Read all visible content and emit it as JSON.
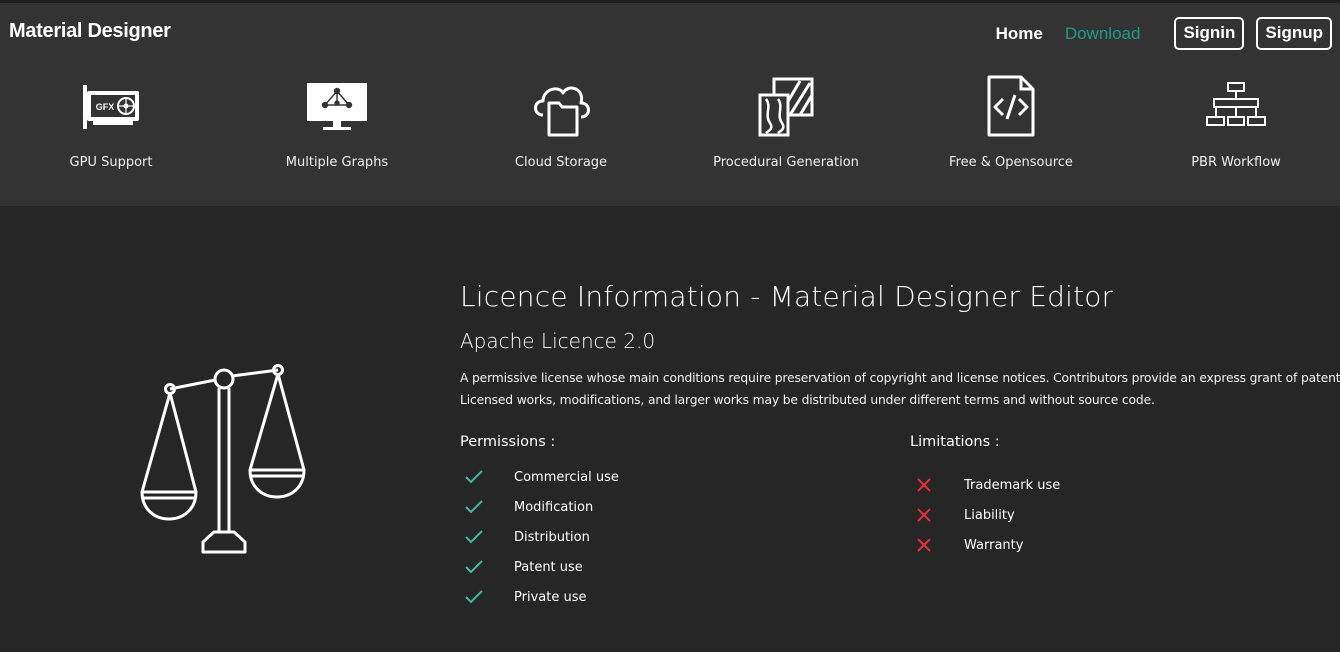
{
  "header": {
    "brand": "Material Designer",
    "nav": {
      "home": "Home",
      "download": "Download",
      "signin": "Signin",
      "signup": "Signup"
    },
    "active_color": "#1d9a8a"
  },
  "features": [
    {
      "label": "GPU Support",
      "icon": "gpu-card-icon",
      "icon_text": "GFX"
    },
    {
      "label": "Multiple Graphs",
      "icon": "graph-monitor-icon"
    },
    {
      "label": "Cloud Storage",
      "icon": "cloud-folder-icon"
    },
    {
      "label": "Procedural Generation",
      "icon": "procedural-pattern-icon"
    },
    {
      "label": "Free & Opensource",
      "icon": "code-file-icon"
    },
    {
      "label": "PBR Workflow",
      "icon": "workflow-tree-icon"
    }
  ],
  "licence": {
    "title": "Licence Information - Material Designer Editor",
    "subtitle": "Apache Licence 2.0",
    "description_line1": "A permissive license whose main conditions require preservation of copyright and license notices. Contributors provide an express grant of patent rights.",
    "description_line2": "Licensed works, modifications, and larger works may be distributed under different terms and without source code.",
    "permissions_heading": "Permissions :",
    "permissions": [
      "Commercial use",
      "Modification",
      "Distribution",
      "Patent use",
      "Private use"
    ],
    "limitations_heading": "Limitations :",
    "limitations": [
      "Trademark use",
      "Liability",
      "Warranty"
    ],
    "check_color": "#3fb8a3",
    "cross_color": "#e0323c",
    "illustration": "scale-balance-icon"
  }
}
